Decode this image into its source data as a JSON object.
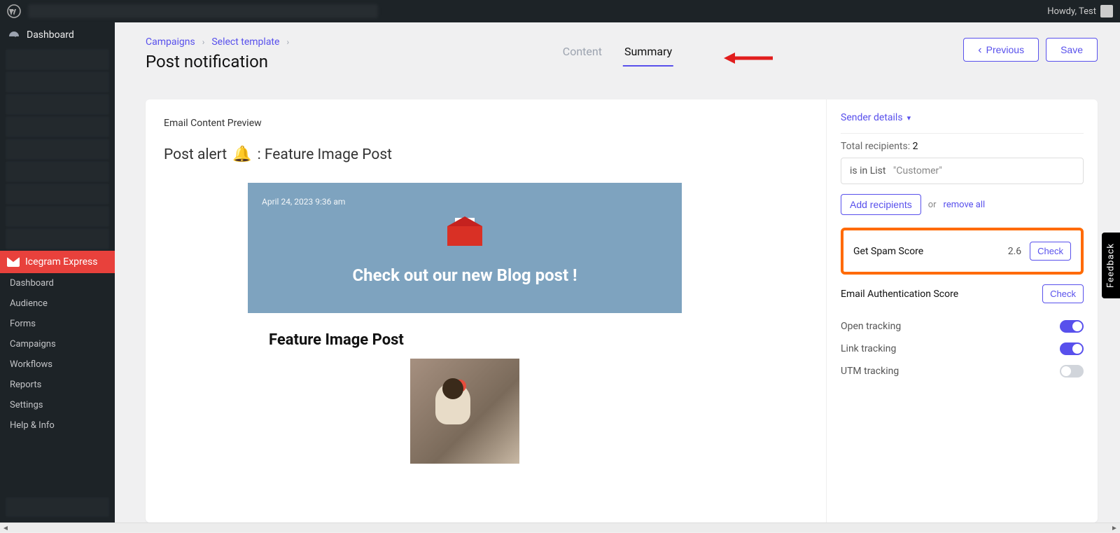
{
  "adminbar": {
    "greeting": "Howdy, Test"
  },
  "sidebar": {
    "dashboard": "Dashboard",
    "active": "Icegram Express",
    "submenu": [
      "Dashboard",
      "Audience",
      "Forms",
      "Campaigns",
      "Workflows",
      "Reports",
      "Settings",
      "Help & Info"
    ]
  },
  "breadcrumb": {
    "campaigns": "Campaigns",
    "select_template": "Select template"
  },
  "page_title": "Post notification",
  "tabs": {
    "content": "Content",
    "summary": "Summary"
  },
  "actions": {
    "previous": "Previous",
    "save": "Save"
  },
  "preview": {
    "label": "Email Content Preview",
    "subject_prefix": "Post alert",
    "subject_suffix": ": Feature Image Post",
    "email_date": "April 24, 2023 9:36 am",
    "headline": "Check out our new Blog post !",
    "post_title": "Feature Image Post"
  },
  "right": {
    "sender": "Sender details",
    "recipients_label": "Total recipients:",
    "recipients_count": "2",
    "list_prefix": "is in List",
    "list_value": "\"Customer\"",
    "add_recipients": "Add recipients",
    "or": "or",
    "remove_all": "remove all",
    "spam_label": "Get Spam Score",
    "spam_score": "2.6",
    "check": "Check",
    "auth_label": "Email Authentication Score",
    "open_tracking": "Open tracking",
    "link_tracking": "Link tracking",
    "utm_tracking": "UTM tracking"
  },
  "feedback": "Feedback"
}
